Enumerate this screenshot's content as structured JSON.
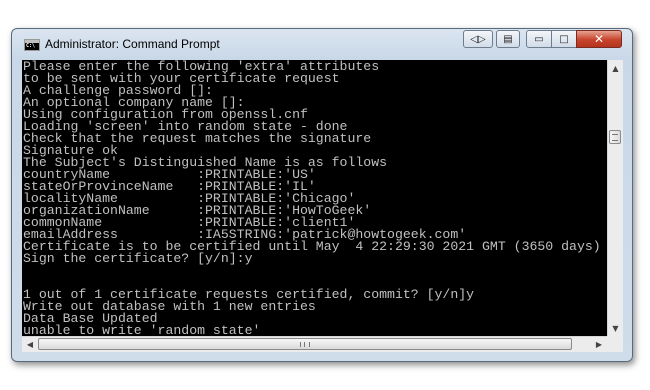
{
  "window": {
    "title": "Administrator: Command Prompt",
    "icon": "cmd-icon",
    "icon_glyph": "C:\\"
  },
  "controls": {
    "extra1_icon": "◁▷",
    "extra2_icon": "▤",
    "minimize_icon": "▭",
    "maximize_icon": "□",
    "close_icon": "✕"
  },
  "console": {
    "lines": [
      "Please enter the following 'extra' attributes",
      "to be sent with your certificate request",
      "A challenge password []:",
      "An optional company name []:",
      "Using configuration from openssl.cnf",
      "Loading 'screen' into random state - done",
      "Check that the request matches the signature",
      "Signature ok",
      "The Subject's Distinguished Name is as follows",
      "countryName           :PRINTABLE:'US'",
      "stateOrProvinceName   :PRINTABLE:'IL'",
      "localityName          :PRINTABLE:'Chicago'",
      "organizationName      :PRINTABLE:'HowToGeek'",
      "commonName            :PRINTABLE:'client1'",
      "emailAddress          :IA5STRING:'patrick@howtogeek.com'",
      "Certificate is to be certified until May  4 22:29:30 2021 GMT (3650 days)",
      "Sign the certificate? [y/n]:y",
      "",
      "",
      "1 out of 1 certificate requests certified, commit? [y/n]y",
      "Write out database with 1 new entries",
      "Data Base Updated",
      "unable to write 'random state'"
    ]
  },
  "scrollbars": {
    "vertical_up": "▲",
    "vertical_down": "▼",
    "horizontal_left": "◀",
    "horizontal_right": "▶"
  }
}
